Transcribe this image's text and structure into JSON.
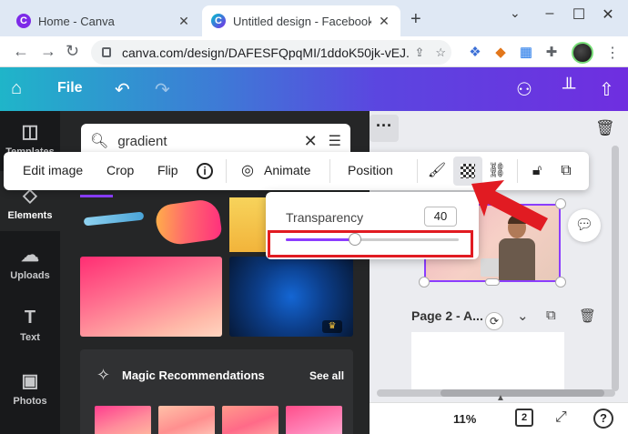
{
  "browser": {
    "tabs": [
      {
        "title": "Home - Canva",
        "active": false
      },
      {
        "title": "Untitled design - Facebook Cov",
        "active": true
      }
    ],
    "new_tab": "+",
    "url": "canva.com/design/DAFESFQpqMI/1ddoK50jk-vEJ..."
  },
  "canva": {
    "file_label": "File",
    "rail": [
      {
        "label": "Templates",
        "icon": "templates-icon"
      },
      {
        "label": "Elements",
        "icon": "elements-icon",
        "active": true
      },
      {
        "label": "Uploads",
        "icon": "uploads-icon"
      },
      {
        "label": "Text",
        "icon": "text-icon"
      },
      {
        "label": "Photos",
        "icon": "photos-icon"
      }
    ],
    "search": {
      "value": "gradient"
    },
    "magic": {
      "title": "Magic Recommendations",
      "see_all": "See all"
    },
    "toolbar": {
      "edit_image": "Edit image",
      "crop": "Crop",
      "flip": "Flip",
      "info": "i",
      "animate": "Animate",
      "position": "Position"
    },
    "transparency": {
      "label": "Transparency",
      "value": "40",
      "level": 0.4
    },
    "page2_label": "Page 2 - A...",
    "zoom": "11%",
    "page_count": "2",
    "help": "?"
  },
  "colors": {
    "accent": "#8b3dff",
    "annotation": "#e11b22"
  }
}
